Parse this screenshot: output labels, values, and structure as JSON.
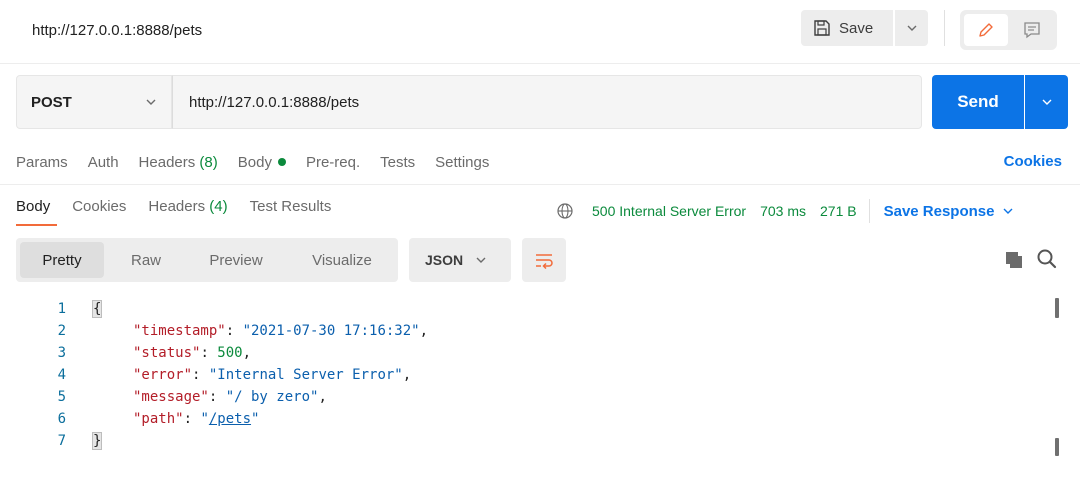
{
  "tab_title": "http://127.0.0.1:8888/pets",
  "header": {
    "save_label": "Save"
  },
  "request": {
    "method": "POST",
    "url": "http://127.0.0.1:8888/pets",
    "send_label": "Send"
  },
  "req_tabs": {
    "params": "Params",
    "auth": "Auth",
    "headers": "Headers",
    "headers_count": "(8)",
    "body": "Body",
    "prereq": "Pre-req.",
    "tests": "Tests",
    "settings": "Settings",
    "cookies": "Cookies"
  },
  "resp_tabs": {
    "body": "Body",
    "cookies": "Cookies",
    "headers": "Headers",
    "headers_count": "(4)",
    "test_results": "Test Results"
  },
  "response": {
    "status": "500 Internal Server Error",
    "time": "703 ms",
    "size": "271 B",
    "save_response": "Save Response"
  },
  "format": {
    "pretty": "Pretty",
    "raw": "Raw",
    "preview": "Preview",
    "visualize": "Visualize",
    "language": "JSON"
  },
  "code": {
    "line_numbers": [
      "1",
      "2",
      "3",
      "4",
      "5",
      "6",
      "7"
    ],
    "open_brace": "{",
    "close_brace": "}",
    "entries": [
      {
        "key": "\"timestamp\"",
        "value": "\"2021-07-30 17:16:32\"",
        "trail": ","
      },
      {
        "key": "\"status\"",
        "value": "500",
        "trail": ","
      },
      {
        "key": "\"error\"",
        "value": "\"Internal Server Error\"",
        "trail": ","
      },
      {
        "key": "\"message\"",
        "value": "\"/ by zero\"",
        "trail": ","
      },
      {
        "key": "\"path\"",
        "value_prefix": "\"",
        "value_link": "/pets",
        "value_suffix": "\"",
        "trail": ""
      }
    ]
  },
  "colors": {
    "send_blue": "#0c74e6",
    "status_green": "#0b8a3c",
    "tab_accent": "#f26b3a"
  },
  "icons": [
    "save-icon",
    "chevron-down-icon",
    "pencil-icon",
    "comment-icon",
    "globe-icon",
    "wrap-lines-icon",
    "copy-icon",
    "search-icon"
  ]
}
